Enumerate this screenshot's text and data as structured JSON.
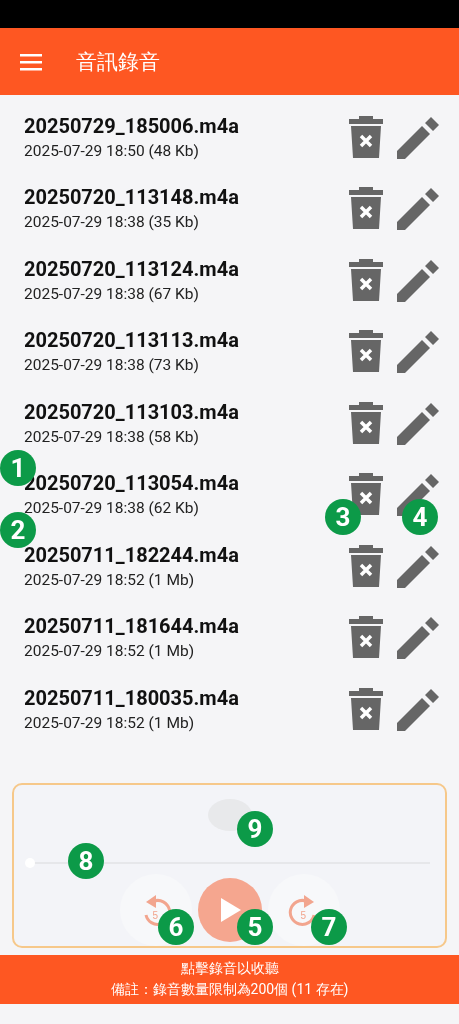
{
  "app_bar": {
    "title": "音訊錄音"
  },
  "recordings": [
    {
      "name": "20250729_185006.m4a",
      "details": "2025-07-29 18:50 (48 Kb)"
    },
    {
      "name": "20250720_113148.m4a",
      "details": "2025-07-29 18:38 (35 Kb)"
    },
    {
      "name": "20250720_113124.m4a",
      "details": "2025-07-29 18:38 (67 Kb)"
    },
    {
      "name": "20250720_113113.m4a",
      "details": "2025-07-29 18:38 (73 Kb)"
    },
    {
      "name": "20250720_113103.m4a",
      "details": "2025-07-29 18:38 (58 Kb)"
    },
    {
      "name": "20250720_113054.m4a",
      "details": "2025-07-29 18:38 (62 Kb)"
    },
    {
      "name": "20250711_182244.m4a",
      "details": "2025-07-29 18:52 (1 Mb)"
    },
    {
      "name": "20250711_181644.m4a",
      "details": "2025-07-29 18:52 (1 Mb)"
    },
    {
      "name": "20250711_180035.m4a",
      "details": "2025-07-29 18:52 (1 Mb)"
    }
  ],
  "player": {
    "level": 0,
    "rewind_label": "5",
    "forward_label": "5"
  },
  "footer": {
    "hint": "點擊錄音以收聽",
    "note": "備註：錄音數量限制為200個 (11 存在)"
  },
  "callouts": [
    {
      "label": "1"
    },
    {
      "label": "3"
    },
    {
      "label": "4"
    },
    {
      "label": "2"
    },
    {
      "label": "9"
    },
    {
      "label": "8"
    },
    {
      "label": "6"
    },
    {
      "label": "5"
    },
    {
      "label": "7"
    }
  ]
}
